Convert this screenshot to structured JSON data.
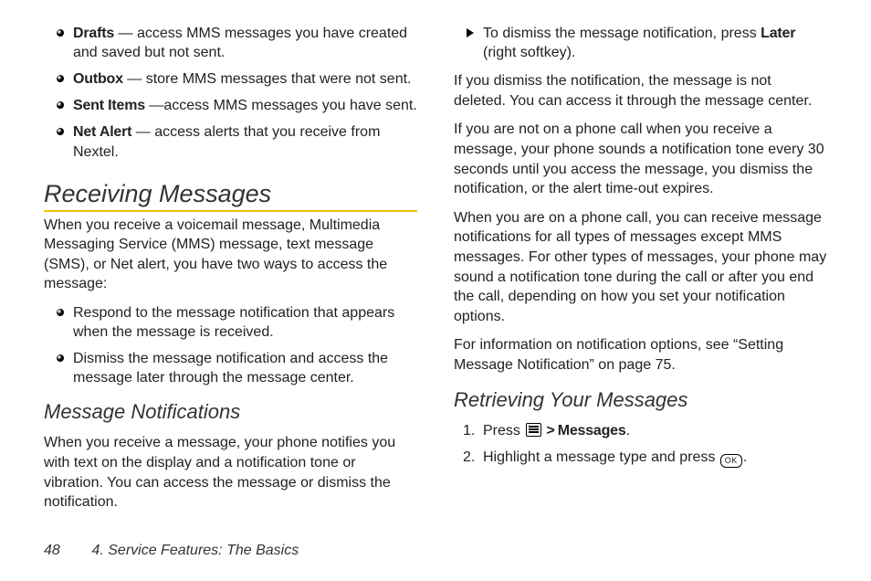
{
  "folders": [
    {
      "label": "Drafts",
      "desc": " — access MMS messages you have created and saved but not sent."
    },
    {
      "label": "Outbox",
      "desc": " — store MMS messages that were not sent."
    },
    {
      "label": "Sent Items",
      "desc": " —access MMS messages you have sent."
    },
    {
      "label": "Net Alert",
      "desc": " — access alerts that you receive from Nextel."
    }
  ],
  "section1_title": "Receiving Messages",
  "section1_intro": "When you receive a voicemail message, Multimedia Messaging Service (MMS) message, text message (SMS), or Net alert, you have two ways to access the message:",
  "section1_list": [
    "Respond to the message notification that appears when the message is received.",
    "Dismiss the message notification and access the message later through the message center."
  ],
  "sub1_title": "Message Notifications",
  "sub1_p1": "When you receive a message, your phone notifies you with text on the display and a notification tone or vibration. You can access the message or dismiss the notification.",
  "dismiss_prefix": "To dismiss the message notification, press ",
  "dismiss_bold": "Later",
  "dismiss_suffix": " (right softkey).",
  "p_after_dismiss": "If you dismiss the notification, the message is not deleted. You can access it through the message center.",
  "p_not_on_call": "If you are not on a phone call when you receive a message, your phone sounds a notification tone every 30 seconds until you access the message, you dismiss the notification, or the alert time-out expires.",
  "p_on_call": "When you are on a phone call, you can receive message notifications for all types of messages except MMS messages. For other types of messages, your phone may sound a notification tone during the call or after you end the call, depending on how you set your notification options.",
  "p_info": "For information on notification options, see “Setting Message Notification” on page 75.",
  "sub2_title": "Retrieving Your Messages",
  "step1_prefix": "Press ",
  "step1_bold": "Messages",
  "step1_suffix": ".",
  "step2_prefix": "Highlight a message type and press ",
  "step2_suffix": ".",
  "ok_label": "OK",
  "footer_page": "48",
  "footer_text": "4. Service Features: The Basics"
}
